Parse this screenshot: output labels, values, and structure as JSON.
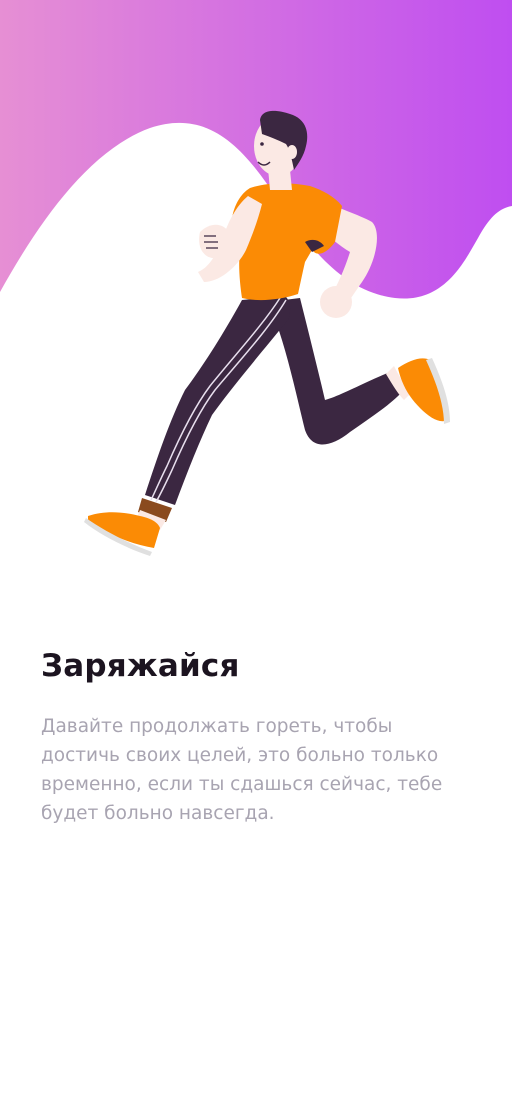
{
  "onboarding": {
    "title": "Заряжайся",
    "description": "Давайте продолжать гореть, чтобы достичь своих целей, это больно только временно, если ты сдашься сейчас, тебе будет больно навсегда."
  },
  "illustration": {
    "subject": "running-man",
    "gradient_start": "#e68fd4",
    "gradient_end": "#bf4ef0",
    "shirt_color": "#fb8b05",
    "pants_color": "#3b2741",
    "shoe_color": "#fb8b05",
    "skin_color": "#fbe9e4",
    "hair_color": "#3b2741"
  }
}
